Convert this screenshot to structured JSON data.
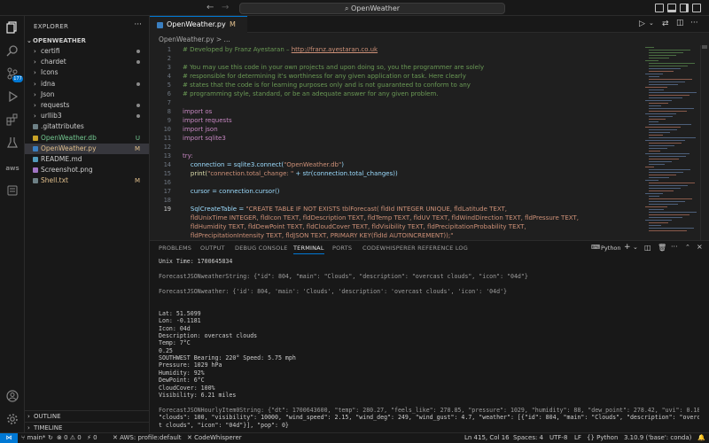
{
  "titlebar": {
    "search_text": "OpenWeather",
    "back_icon": "arrow-left-icon",
    "forward_icon": "arrow-right-icon"
  },
  "activity_bar": {
    "items": [
      "explorer-icon",
      "search-icon",
      "source-control-icon",
      "run-debug-icon",
      "extensions-icon",
      "testing-icon",
      "aws-icon",
      "remote-icon"
    ],
    "source_control_badge": "177",
    "account_icon": "account-icon",
    "settings_icon": "gear-icon"
  },
  "sidebar": {
    "header": "EXPLORER",
    "more": "···",
    "root": "OPENWEATHER",
    "items": [
      {
        "label": "certifi",
        "type": "folder",
        "status": "dot"
      },
      {
        "label": "chardet",
        "type": "folder",
        "status": "dot"
      },
      {
        "label": "Icons",
        "type": "folder",
        "status": ""
      },
      {
        "label": "idna",
        "type": "folder",
        "status": "dot"
      },
      {
        "label": "Json",
        "type": "folder",
        "status": ""
      },
      {
        "label": "requests",
        "type": "folder",
        "status": "dot"
      },
      {
        "label": "urllib3",
        "type": "folder",
        "status": "dot"
      },
      {
        "label": ".gitattributes",
        "type": "file",
        "status": ""
      },
      {
        "label": "OpenWeather.db",
        "type": "file",
        "status": "U"
      },
      {
        "label": "OpenWeather.py",
        "type": "file",
        "status": "M"
      },
      {
        "label": "README.md",
        "type": "file",
        "status": ""
      },
      {
        "label": "Screenshot.png",
        "type": "file",
        "status": ""
      },
      {
        "label": "Shell.txt",
        "type": "file",
        "status": "M"
      }
    ],
    "outline": "OUTLINE",
    "timeline": "TIMELINE"
  },
  "editor": {
    "tab_label": "OpenWeather.py",
    "tab_status": "M",
    "breadcrumb": "OpenWeather.py > ...",
    "line_numbers": [
      "1",
      "2",
      "3",
      "4",
      "5",
      "6",
      "7",
      "8",
      "9",
      "10",
      "11",
      "12",
      "13",
      "14",
      "15",
      "16",
      "17",
      "18",
      "19"
    ],
    "lines": {
      "l1a": "# Developed by Franz Ayestaran – ",
      "l1b": "http://franz.ayestaran.co.uk",
      "l3": "# You may use this code in your own projects and upon doing so, you the programmer are solely",
      "l4": "# responsible for determining it's worthiness for any given application or task. Here clearly",
      "l5": "# states that the code is for learning purposes only and is not guaranteed to conform to any",
      "l6": "# programming style, standard, or be an adequate answer for any given problem.",
      "l8": "import os",
      "l9": "import requests",
      "l10": "import json",
      "l11": "import sqlite3",
      "l13": "try:",
      "l14a": "    connection = sqlite3.connect(",
      "l14b": "\"OpenWeather.db\"",
      "l14c": ")",
      "l15a": "    print(",
      "l15b": "\"connection.total_change: \"",
      "l15c": " + str(connection.total_changes))",
      "l17": "    cursor = connection.cursor()",
      "l19a": "    SqlCreateTable = ",
      "l19b": "\"CREATE TABLE IF NOT EXISTS tblForecast( fldId INTEGER UNIQUE, fldLatitude TEXT,",
      "l19c": "    fldUnixTime INTEGER, fldIcon TEXT, fldDescription TEXT, fldTemp TEXT, fldUV TEXT, fldWindDirection TEXT, fldPressure TEXT,",
      "l19d": "    fldHumidity TEXT, fldDewPoint TEXT, fldCloudCover TEXT, fldVisibility TEXT, fldPrecipitationProbability TEXT,",
      "l19e": "    fldPrecipitationIntensity TEXT, fldJSON TEXT, PRIMARY KEY(fldId AUTOINCREMENT));\""
    }
  },
  "panel": {
    "tabs": [
      "PROBLEMS",
      "OUTPUT",
      "DEBUG CONSOLE",
      "TERMINAL",
      "PORTS",
      "CODEWHISPERER REFERENCE LOG"
    ],
    "active_tab": "TERMINAL",
    "shell": "Python",
    "terminal_lines": [
      "Unix Time: 1700645834",
      "",
      "ForecastJSONweatherString: {\"id\": 804, \"main\": \"Clouds\", \"description\": \"overcast clouds\", \"icon\": \"04d\"}",
      "",
      "ForecastJSONweather: {'id': 804, 'main': 'Clouds', 'description': 'overcast clouds', 'icon': '04d'}",
      "",
      "",
      "Lat: 51.5099",
      "Lon: -0.1181",
      "Icon: 04d",
      "Description: overcast clouds",
      "Temp: 7°C",
      "0.25",
      "SOUTHWEST Bearing: 220° Speed: 5.75 mph",
      "Pressure: 1029 hPa",
      "Humidity: 92%",
      "DewPoint: 6°C",
      "CloudCover: 100%",
      "Visibility: 6.21 miles",
      "",
      "ForecastJSONHourlyItem0String: {\"dt\": 1700643600, \"temp\": 280.27, \"feels_like\": 278.85, \"pressure\": 1029, \"humidity\": 88, \"dew_point\": 278.42, \"uvi\": 0.18,",
      "\"clouds\": 100, \"visibility\": 10000, \"wind_speed\": 2.15, \"wind_deg\": 249, \"wind_gust\": 4.7, \"weather\": [{\"id\": 804, \"main\": \"Clouds\", \"description\": \"overcas",
      "t clouds\", \"icon\": \"04d\"}], \"pop\": 0}",
      "",
      "ForecastJSONHourlyItem0: {'dt': 1700643600, 'temp': 280.27, 'feels_like': 278.85, 'pressure': 1029, 'humidity': 88, 'dew_point': 278.42, 'uvi': 0.18, 'cloud",
      "s': 100, 'visibility': 10000, 'wind_speed': 2.15, 'wind_deg': 249, 'wind_gust': 4.7, 'weather': [{'id': 804, 'main': 'Clouds', 'description': 'overcast clou"
    ]
  },
  "statusbar": {
    "branch": "main*",
    "problems": "0 ⚠ 0",
    "ports": "0",
    "aws": "AWS: profile:default",
    "codewhisperer": "CodeWhisperer",
    "position": "Ln 415, Col 16",
    "spaces": "Spaces: 4",
    "encoding": "UTF-8",
    "eol": "LF",
    "language": "Python",
    "interpreter": "3.10.9 ('base': conda)"
  },
  "colors": {
    "accent": "#0078d4",
    "background": "#1f1f1f",
    "sidebar": "#181818"
  }
}
